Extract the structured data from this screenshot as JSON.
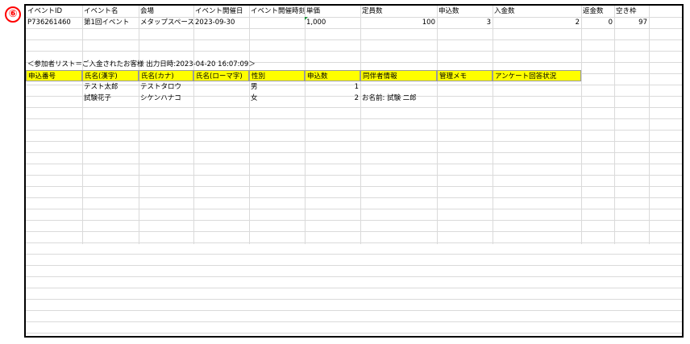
{
  "badge": "⑥",
  "header_row": [
    "イベントID",
    "イベント名",
    "会場",
    "イベント開催日",
    "イベント開催時刻",
    "単価",
    "定員数",
    "申込数",
    "入金数",
    "返金数",
    "空き枠"
  ],
  "event_row": {
    "event_id": "P736261460",
    "event_name": "第1回イベント",
    "venue": "メタップスペース",
    "date": "2023-09-30",
    "time": "",
    "price": "1,000",
    "capacity": "100",
    "applications": "3",
    "paid": "2",
    "refunds": "0",
    "available": "97"
  },
  "list_title": "＜参加者リスト＝ご入金されたお客様 出力日時:2023-04-20 16:07:09＞",
  "participant_headers": [
    "申込番号",
    "氏名(漢字)",
    "氏名(カナ)",
    "氏名(ローマ字)",
    "性別",
    "申込数",
    "同伴者情報",
    "管理メモ",
    "アンケート回答状況"
  ],
  "participants": [
    {
      "app_no": "",
      "name_kanji": "テスト太郎",
      "name_kana": "テストタロウ",
      "name_roman": "",
      "gender": "男",
      "count": "1",
      "companion": "",
      "memo": "",
      "survey": ""
    },
    {
      "app_no": "",
      "name_kanji": "試験花子",
      "name_kana": "シケンハナコ",
      "name_roman": "",
      "gender": "女",
      "count": "2",
      "companion": "お名前: 試験 二郎",
      "memo": "",
      "survey": ""
    }
  ],
  "colors": {
    "header_fill": "#ffff00",
    "badge": "#ff0000",
    "gridline": "#dadada",
    "error_marker": "#1e8f3b"
  }
}
